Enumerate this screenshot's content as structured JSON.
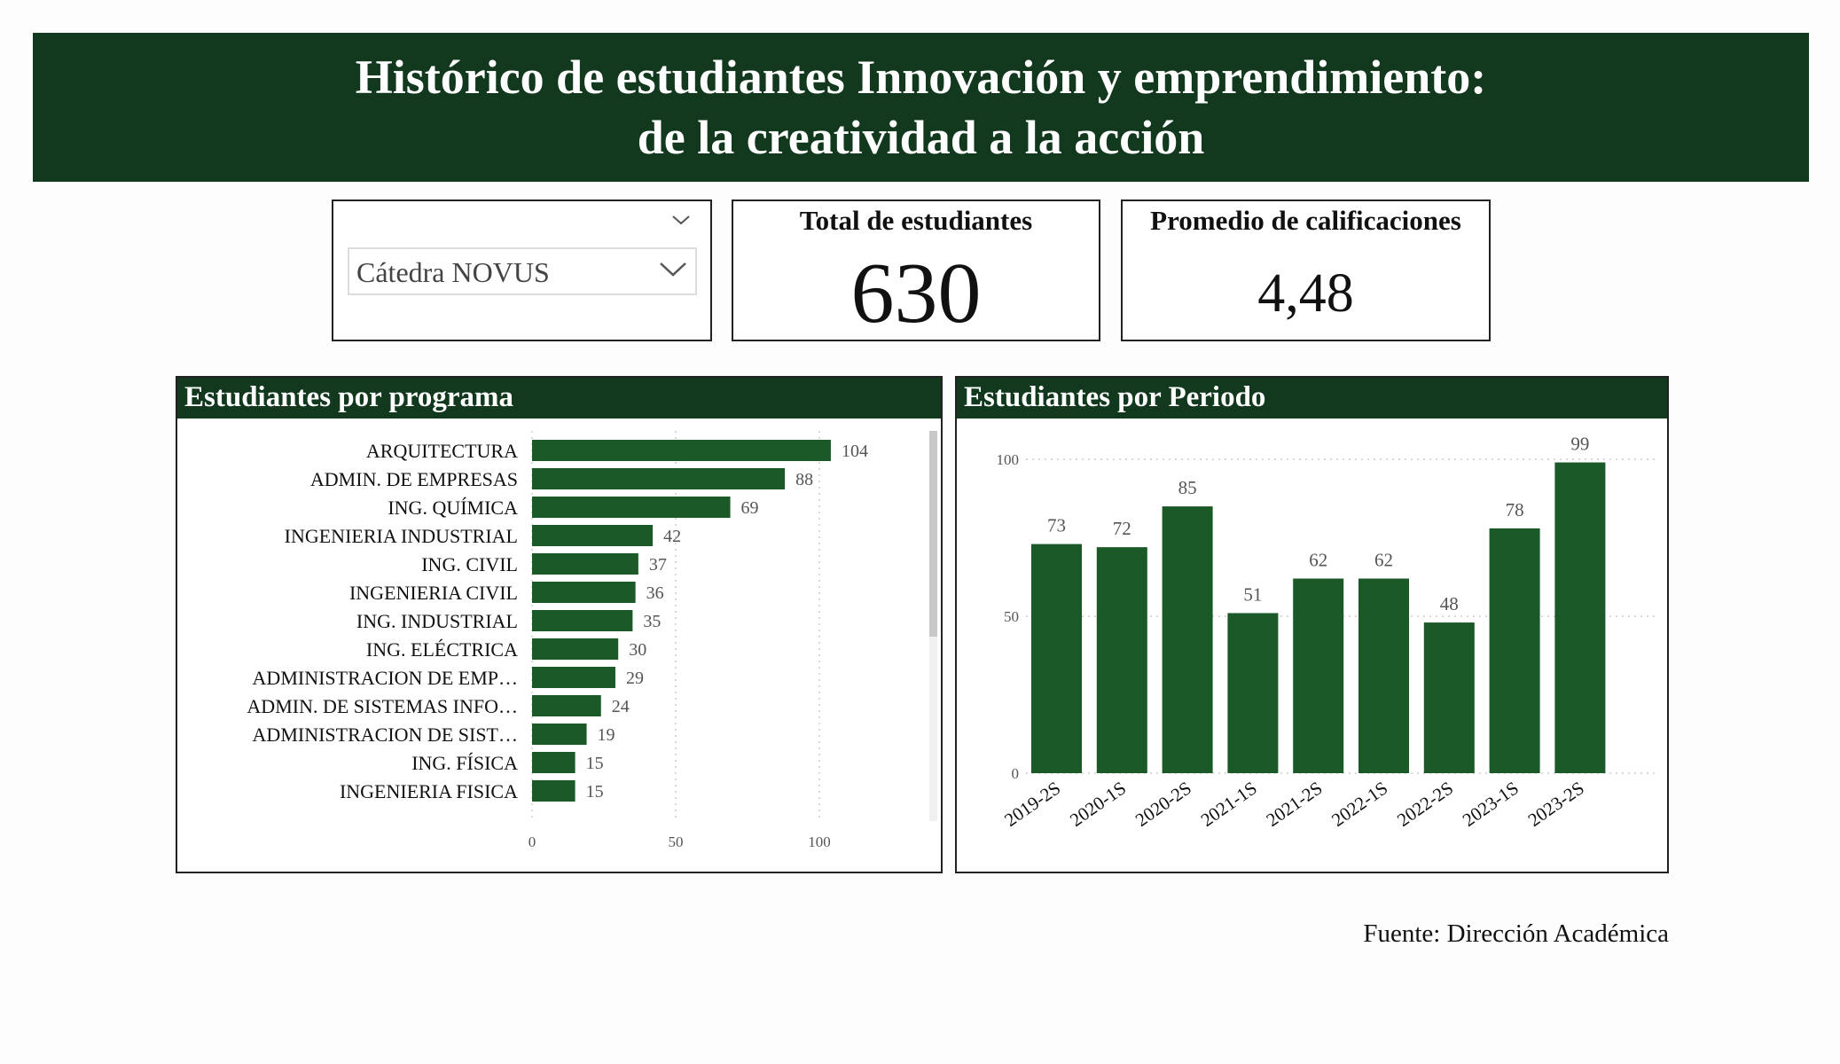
{
  "header": {
    "title_line1": "Histórico de estudiantes Innovación y emprendimiento:",
    "title_line2": "de la creatividad a la acción"
  },
  "slicer": {
    "selected": "Cátedra NOVUS",
    "icon": "chevron-down-icon"
  },
  "kpis": {
    "total_label": "Total de estudiantes",
    "total_value": "630",
    "avg_label": "Promedio de calificaciones",
    "avg_value": "4,48"
  },
  "footer": {
    "source": "Fuente: Dirección Académica"
  },
  "colors": {
    "accent": "#12391e",
    "bar": "#1b5a28",
    "grid": "#cccccc"
  },
  "chart_data": [
    {
      "type": "bar",
      "orientation": "horizontal",
      "title": "Estudiantes por programa",
      "categories": [
        "ARQUITECTURA",
        "ADMIN. DE EMPRESAS",
        "ING. QUÍMICA",
        "INGENIERIA INDUSTRIAL",
        "ING. CIVIL",
        "INGENIERIA CIVIL",
        "ING. INDUSTRIAL",
        "ING. ELÉCTRICA",
        "ADMINISTRACION DE EMP…",
        "ADMIN. DE SISTEMAS INFO…",
        "ADMINISTRACION DE SIST…",
        "ING. FÍSICA",
        "INGENIERIA FISICA"
      ],
      "values": [
        104,
        88,
        69,
        42,
        37,
        36,
        35,
        30,
        29,
        24,
        19,
        15,
        15
      ],
      "xticks": [
        0,
        50,
        100
      ],
      "xlim": [
        0,
        125
      ],
      "grid": true,
      "data_labels": true
    },
    {
      "type": "bar",
      "title": "Estudiantes por Periodo",
      "categories": [
        "2019-2S",
        "2020-1S",
        "2020-2S",
        "2021-1S",
        "2021-2S",
        "2022-1S",
        "2022-2S",
        "2023-1S",
        "2023-2S"
      ],
      "values": [
        73,
        72,
        85,
        51,
        62,
        62,
        48,
        78,
        99
      ],
      "yticks": [
        0,
        50,
        100
      ],
      "ylim": [
        0,
        100
      ],
      "grid": true,
      "data_labels": true
    }
  ]
}
